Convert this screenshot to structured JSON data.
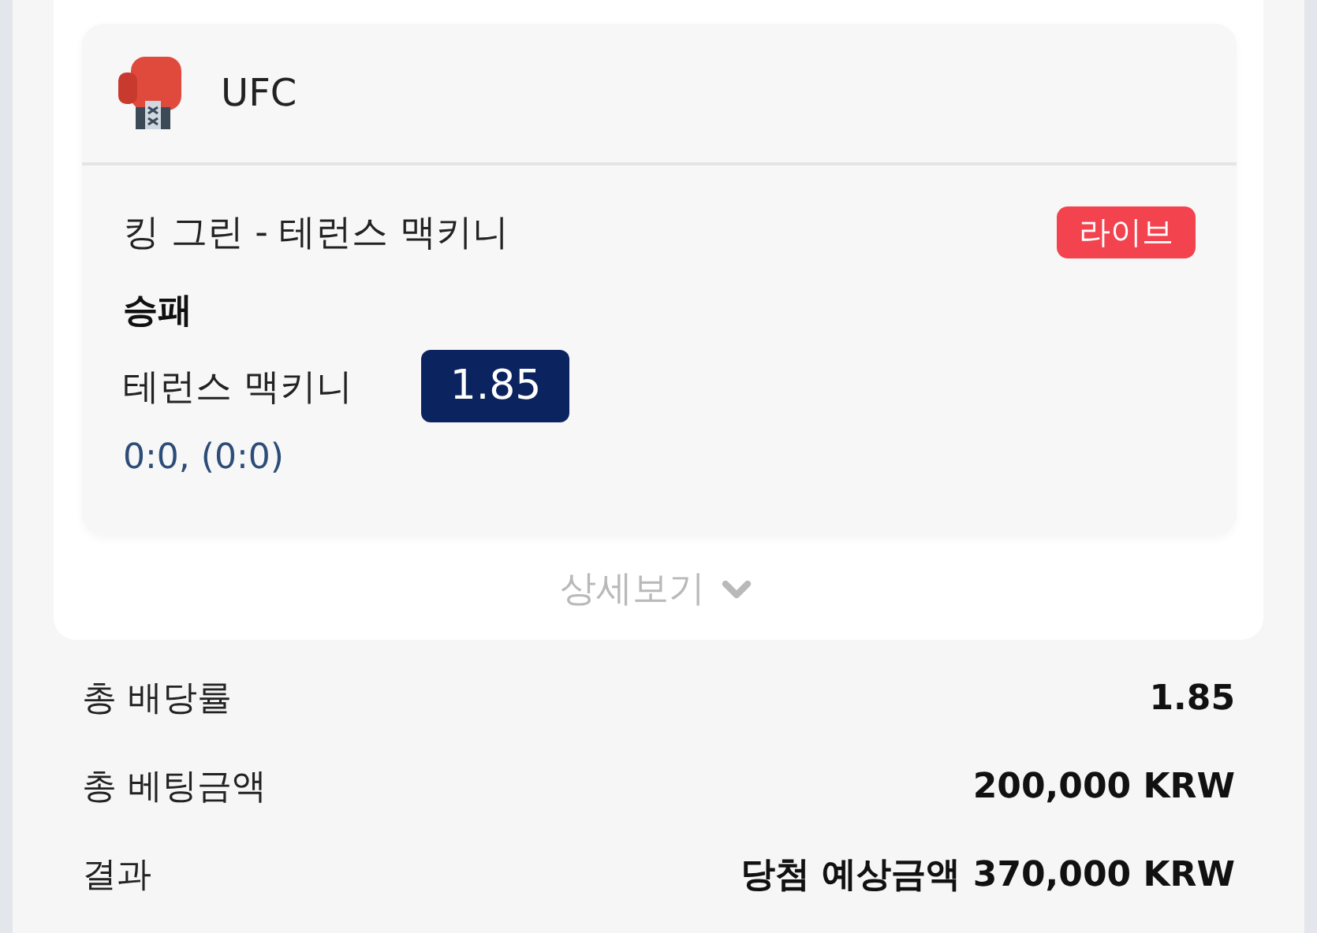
{
  "league": {
    "name": "UFC"
  },
  "bet": {
    "match": "킹 그린 - 테런스 맥키니",
    "badge": "라이브",
    "market": "승패",
    "pick": "테런스 맥키니",
    "odds": "1.85",
    "score": "0:0, (0:0)"
  },
  "details_toggle": {
    "label": "상세보기",
    "expanded": false
  },
  "summary": [
    {
      "label": "총 배당률",
      "value": "1.85"
    },
    {
      "label": "총 베팅금액",
      "value": "200,000 KRW"
    },
    {
      "label": "결과",
      "value": "당첨 예상금액 370,000 KRW"
    }
  ]
}
